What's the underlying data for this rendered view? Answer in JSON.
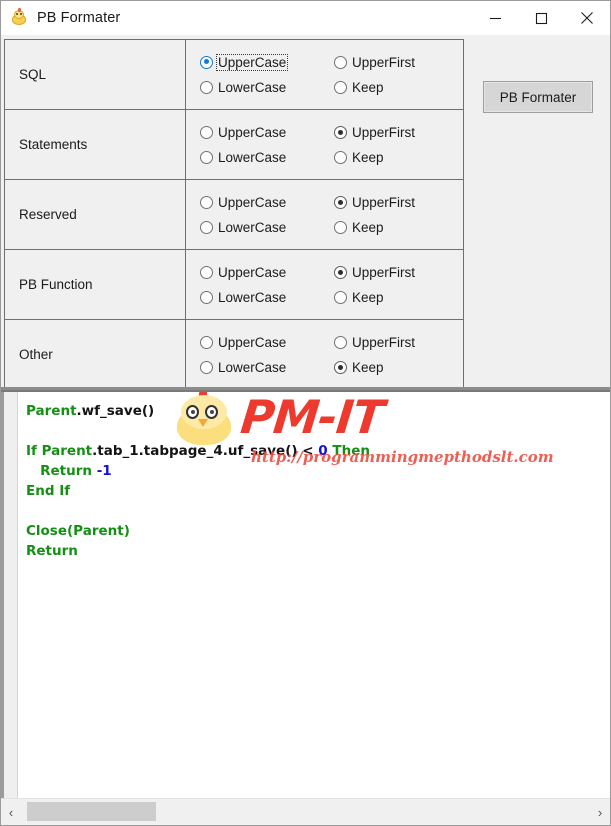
{
  "window": {
    "title": "PB Formater",
    "icon": "chick-icon",
    "controls": {
      "minimize": "minimize-button",
      "maximize": "maximize-button",
      "close": "close-button"
    }
  },
  "options": {
    "columns": [
      "UpperCase",
      "LowerCase",
      "UpperFirst",
      "Keep"
    ],
    "rows": [
      {
        "label": "SQL",
        "choices": [
          {
            "label": "UpperCase",
            "selected": true,
            "focused": true
          },
          {
            "label": "LowerCase",
            "selected": false,
            "focused": false
          },
          {
            "label": "UpperFirst",
            "selected": false,
            "focused": false
          },
          {
            "label": "Keep",
            "selected": false,
            "focused": false
          }
        ]
      },
      {
        "label": "Statements",
        "choices": [
          {
            "label": "UpperCase",
            "selected": false,
            "focused": false
          },
          {
            "label": "LowerCase",
            "selected": false,
            "focused": false
          },
          {
            "label": "UpperFirst",
            "selected": true,
            "focused": false
          },
          {
            "label": "Keep",
            "selected": false,
            "focused": false
          }
        ]
      },
      {
        "label": "Reserved",
        "choices": [
          {
            "label": "UpperCase",
            "selected": false,
            "focused": false
          },
          {
            "label": "LowerCase",
            "selected": false,
            "focused": false
          },
          {
            "label": "UpperFirst",
            "selected": true,
            "focused": false
          },
          {
            "label": "Keep",
            "selected": false,
            "focused": false
          }
        ]
      },
      {
        "label": "PB Function",
        "choices": [
          {
            "label": "UpperCase",
            "selected": false,
            "focused": false
          },
          {
            "label": "LowerCase",
            "selected": false,
            "focused": false
          },
          {
            "label": "UpperFirst",
            "selected": true,
            "focused": false
          },
          {
            "label": "Keep",
            "selected": false,
            "focused": false
          }
        ]
      },
      {
        "label": "Other",
        "choices": [
          {
            "label": "UpperCase",
            "selected": false,
            "focused": false
          },
          {
            "label": "LowerCase",
            "selected": false,
            "focused": false
          },
          {
            "label": "UpperFirst",
            "selected": false,
            "focused": false
          },
          {
            "label": "Keep",
            "selected": true,
            "focused": false
          }
        ]
      }
    ]
  },
  "action": {
    "format_button": "PB Formater"
  },
  "editor": {
    "lines": [
      [
        {
          "t": "Parent",
          "c": "kw"
        },
        {
          "t": ".wf_save()",
          "c": "pl"
        }
      ],
      [],
      [
        {
          "t": "If ",
          "c": "kw"
        },
        {
          "t": "Parent",
          "c": "kw"
        },
        {
          "t": ".tab_1.tabpage_4.uf_save()",
          "c": "pl"
        },
        {
          "t": " < ",
          "c": "pl"
        },
        {
          "t": "0",
          "c": "num"
        },
        {
          "t": " Then",
          "c": "kw"
        }
      ],
      [
        {
          "t": "   Return ",
          "c": "kw"
        },
        {
          "t": "-1",
          "c": "num"
        }
      ],
      [
        {
          "t": "End If",
          "c": "kw"
        }
      ],
      [],
      [
        {
          "t": "Close",
          "c": "kw"
        },
        {
          "t": "(Parent)",
          "c": "kw"
        }
      ],
      [
        {
          "t": "Return",
          "c": "kw"
        }
      ]
    ],
    "colors": {
      "keyword": "#139013",
      "number": "#1111d8",
      "plain": "#141414"
    }
  },
  "watermark": {
    "brand": "PM-IT",
    "url": "http://programmingmepthodslt.com",
    "logo": "chick-logo",
    "color": "#ee3a2e"
  },
  "scrollbar": {
    "left_arrow": "‹",
    "right_arrow": "›"
  }
}
